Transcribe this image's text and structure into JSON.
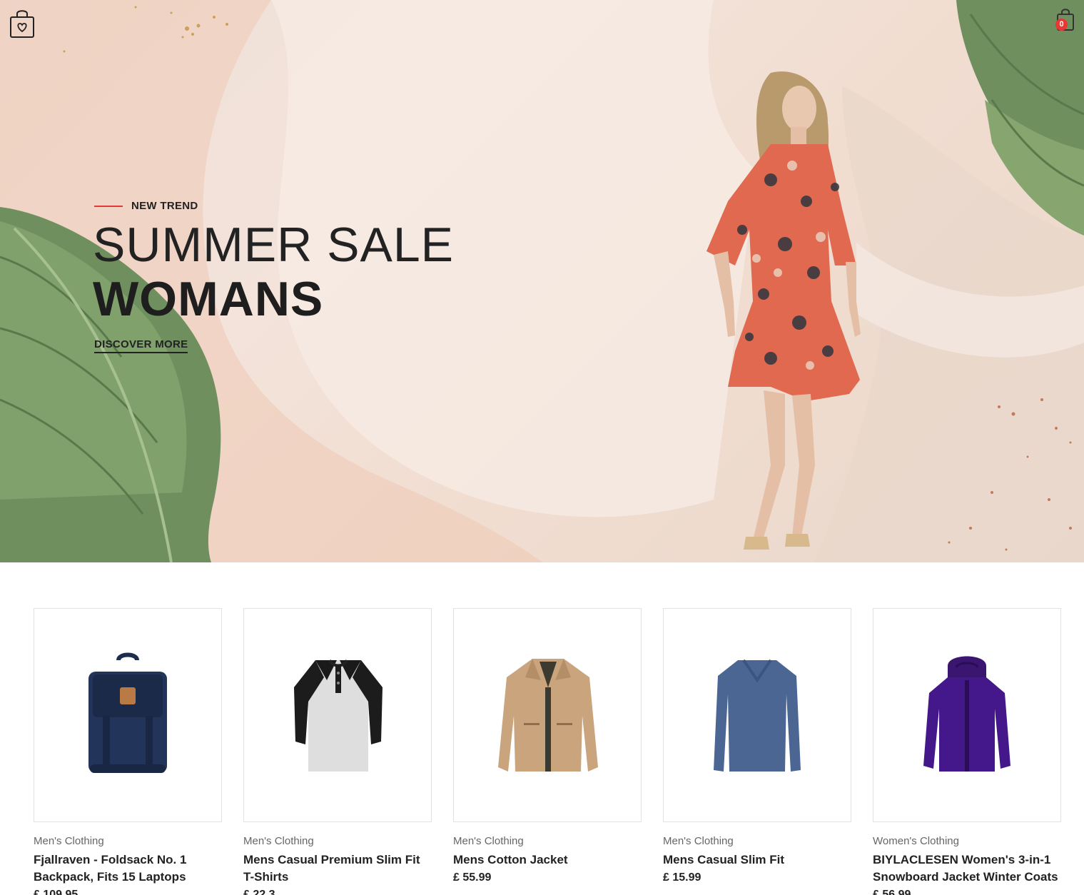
{
  "header": {
    "logo_icon": "shopping-bag-heart-icon",
    "cart_icon": "shopping-bag-icon",
    "cart_count": "0",
    "accent": "#e53935"
  },
  "hero": {
    "eyebrow": "NEW TREND",
    "title_line1": "SUMMER SALE",
    "title_line2": "WOMANS",
    "cta": "DISCOVER MORE"
  },
  "products": [
    {
      "category": "Men's Clothing",
      "title": "Fjallraven - Foldsack No. 1 Backpack, Fits 15 Laptops",
      "price": "£ 109.95",
      "image_icon": "backpack-image"
    },
    {
      "category": "Men's Clothing",
      "title": "Mens Casual Premium Slim Fit T-Shirts",
      "price": "£ 22.3",
      "image_icon": "raglan-tshirt-image"
    },
    {
      "category": "Men's Clothing",
      "title": "Mens Cotton Jacket",
      "price": "£ 55.99",
      "image_icon": "cotton-jacket-image"
    },
    {
      "category": "Men's Clothing",
      "title": "Mens Casual Slim Fit",
      "price": "£ 15.99",
      "image_icon": "longsleeve-shirt-image"
    },
    {
      "category": "Women's Clothing",
      "title": "BIYLACLESEN Women's 3-in-1 Snowboard Jacket Winter Coats",
      "price": "£ 56.99",
      "image_icon": "snowboard-jacket-image"
    }
  ]
}
